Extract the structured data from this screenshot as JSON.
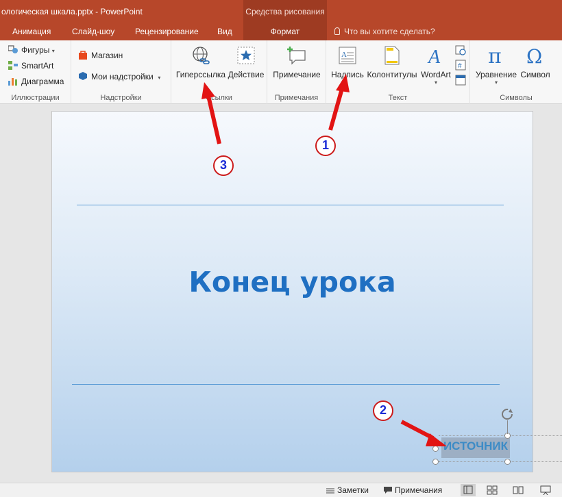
{
  "window": {
    "title": "ологическая шкала.pptx - PowerPoint",
    "context_header": "Средства рисования"
  },
  "tabs": [
    "Анимация",
    "Слайд-шоу",
    "Рецензирование",
    "Вид",
    "Формат"
  ],
  "tell_me": "Что вы хотите сделать?",
  "ribbon": {
    "illustrations": {
      "shapes": "Фигуры",
      "smartart": "SmartArt",
      "chart": "Диаграмма",
      "label": "Иллюстрации"
    },
    "addins": {
      "store": "Магазин",
      "my_addins": "Мои надстройки",
      "label": "Надстройки"
    },
    "links": {
      "hyperlink": "Гиперссылка",
      "action": "Действие",
      "label": "Ссылки"
    },
    "comments": {
      "comment": "Примечание",
      "label": "Примечания"
    },
    "text": {
      "textbox": "Надпись",
      "header_footer": "Колонтитулы",
      "wordart": "WordArt",
      "label": "Текст"
    },
    "symbols": {
      "equation": "Уравнение",
      "symbol": "Символ",
      "label": "Символы"
    }
  },
  "slide": {
    "title": "Конец урока",
    "textbox": "ИСТОЧНИК"
  },
  "markers": [
    "1",
    "2",
    "3"
  ],
  "statusbar": {
    "notes": "Заметки",
    "comments": "Примечания"
  },
  "colors": {
    "accent": "#b7472a",
    "context_tab": "#9e3b22",
    "title_text": "#1f6fc2",
    "annotation": "#e21414"
  }
}
